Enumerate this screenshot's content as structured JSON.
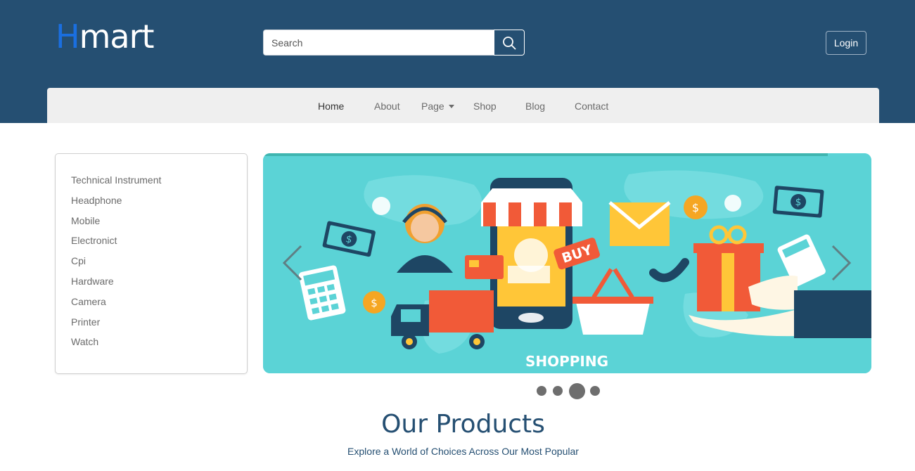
{
  "header": {
    "logo_first": "H",
    "logo_rest": "mart",
    "search_placeholder": "Search",
    "login_label": "Login",
    "colors": {
      "header_bg": "#254f72",
      "logo_accent": "#1a6fe0"
    }
  },
  "nav": {
    "items": [
      {
        "label": "Home",
        "active": true
      },
      {
        "label": "About"
      },
      {
        "label": "Page",
        "dropdown": true
      },
      {
        "label": "Shop"
      },
      {
        "label": "Blog"
      },
      {
        "label": "Contact"
      }
    ]
  },
  "categories": [
    "Technical Instrument",
    "Headphone",
    "Mobile",
    "Electronict",
    "Cpi",
    "Hardware",
    "Camera",
    "Printer",
    "Watch"
  ],
  "carousel": {
    "slide_image_text_buy": "BUY",
    "slide_image_text_shopping": "SHOPPING",
    "slide_count": 4,
    "active_slide": 3,
    "prev_icon": "chevron-left-icon",
    "next_icon": "chevron-right-icon"
  },
  "section": {
    "title": "Our Products",
    "subtitle": "Explore a World of Choices Across Our Most Popular"
  }
}
